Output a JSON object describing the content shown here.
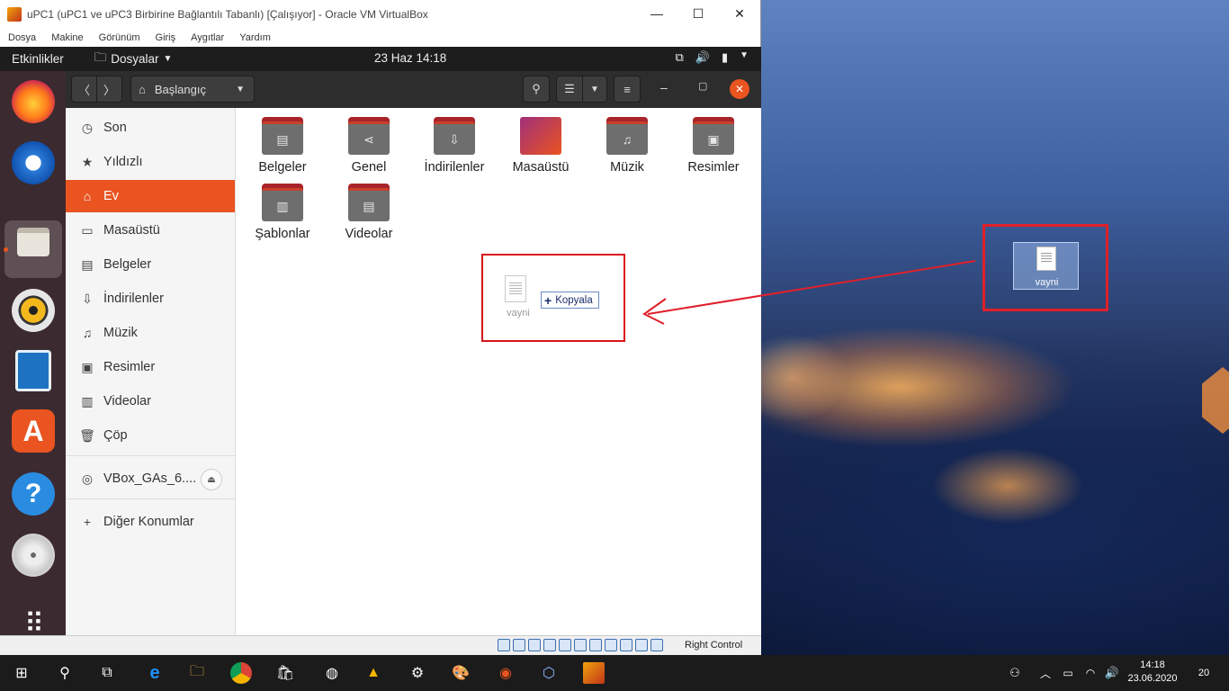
{
  "vbox": {
    "title": "uPC1 (uPC1 ve uPC3 Birbirine Bağlantılı Tabanlı) [Çalışıyor] - Oracle VM VirtualBox",
    "menu": [
      "Dosya",
      "Makine",
      "Görünüm",
      "Giriş",
      "Aygıtlar",
      "Yardım"
    ],
    "status_text": "Right Control"
  },
  "gnome": {
    "activities": "Etkinlikler",
    "app_menu": "Dosyalar",
    "clock": "23 Haz  14:18"
  },
  "nautilus": {
    "path": "Başlangıç",
    "sidebar": [
      {
        "label": "Son",
        "icon": "clock-icon"
      },
      {
        "label": "Yıldızlı",
        "icon": "star-icon"
      },
      {
        "label": "Ev",
        "icon": "home-icon",
        "active": true
      },
      {
        "label": "Masaüstü",
        "icon": "desktop-icon"
      },
      {
        "label": "Belgeler",
        "icon": "document-icon"
      },
      {
        "label": "İndirilenler",
        "icon": "download-icon"
      },
      {
        "label": "Müzik",
        "icon": "music-icon"
      },
      {
        "label": "Resimler",
        "icon": "picture-icon"
      },
      {
        "label": "Videolar",
        "icon": "video-icon"
      },
      {
        "label": "Çöp",
        "icon": "trash-icon"
      }
    ],
    "device": "VBox_GAs_6....",
    "other_locations": "Diğer Konumlar",
    "folders": [
      "Belgeler",
      "Genel",
      "İndirilenler",
      "Masaüstü",
      "Müzik",
      "Resimler",
      "Şablonlar",
      "Videolar"
    ],
    "drag_file": "vayni",
    "drag_tooltip": "Kopyala"
  },
  "desktop": {
    "file": "vayni"
  },
  "taskbar": {
    "time": "14:18",
    "date": "23.06.2020",
    "notifications": "20"
  },
  "colors": {
    "ubuntu_orange": "#e95420",
    "annotation_red": "#e0202a"
  }
}
